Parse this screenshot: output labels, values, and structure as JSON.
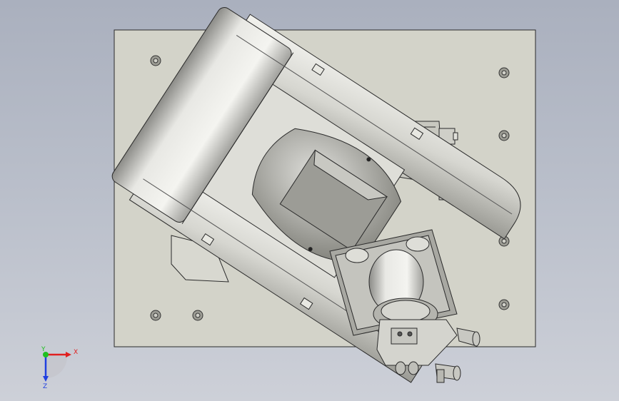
{
  "viewport": {
    "background_top": "#aab0be",
    "background_bottom": "#cdd0d8"
  },
  "triad": {
    "x_label": "X",
    "y_label": "Y",
    "z_label": "Z",
    "x_color": "#e02020",
    "y_color": "#20c020",
    "z_color": "#2040e0"
  },
  "model": {
    "base_plate_color": "#d3d3c9",
    "body_color": "#dcdcd6",
    "edge_color": "#2a2a2a"
  }
}
